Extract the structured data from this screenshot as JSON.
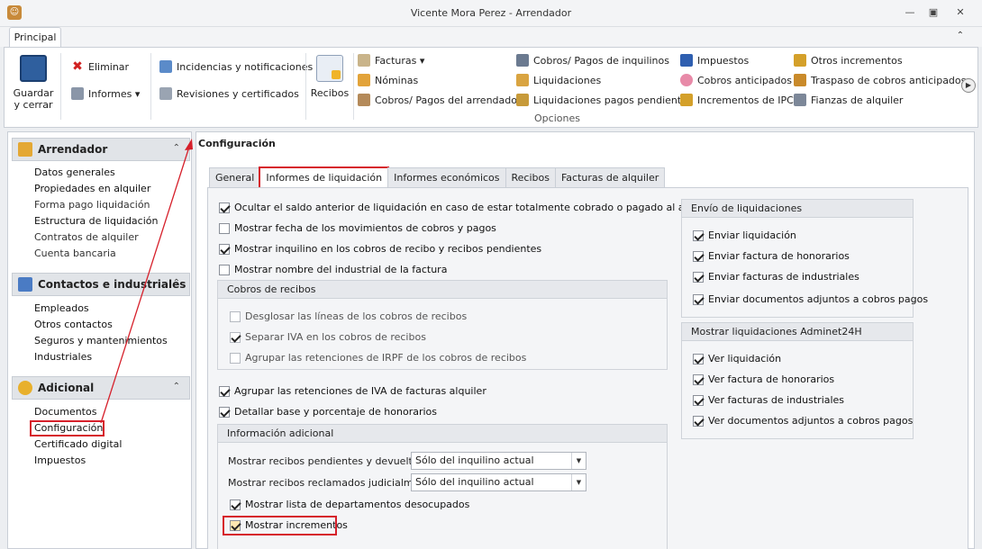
{
  "window": {
    "title": "Vicente Mora Perez - Arrendador",
    "minimize": "—",
    "restore": "▣",
    "close": "✕"
  },
  "ribbon": {
    "tab": "Principal",
    "collapse": "⌃",
    "save": "Guardar y cerrar",
    "delete": "Eliminar",
    "reports": "Informes ▾",
    "incidents": "Incidencias y notificaciones",
    "reviews": "Revisiones y certificados",
    "receipts": "Recibos",
    "invoices": "Facturas ▾",
    "payrolls": "Nóminas",
    "owner_payments": "Cobros/ Pagos del arrendador",
    "tenant_payments": "Cobros/ Pagos de inquilinos",
    "settlements": "Liquidaciones",
    "pending_settlements": "Liquidaciones pagos pendientes",
    "taxes": "Impuestos",
    "advance_payments": "Cobros anticipados",
    "cpi_increments": "Incrementos de IPC",
    "other_increments": "Otros incrementos",
    "advance_transfer": "Traspaso de cobros anticipados",
    "rental_deposits": "Fianzas de alquiler",
    "group_label": "Opciones",
    "more": "▶"
  },
  "sidebar": {
    "sections": [
      {
        "title": "Arrendador",
        "items": [
          "Datos generales",
          "Propiedades en alquiler",
          "Forma pago liquidación",
          "Estructura de liquidación",
          "Contratos de alquiler",
          "Cuenta bancaria"
        ]
      },
      {
        "title": "Contactos e industriales",
        "items": [
          "Empleados",
          "Otros contactos",
          "Seguros y mantenimientos",
          "Industriales"
        ]
      },
      {
        "title": "Adicional",
        "items": [
          "Documentos",
          "Configuración",
          "Certificado digital",
          "Impuestos"
        ]
      }
    ],
    "chevron": "⌃"
  },
  "main": {
    "title": "Configuración",
    "tabs": [
      "General",
      "Informes de liquidación",
      "Informes económicos",
      "Recibos",
      "Facturas de alquiler"
    ],
    "options": {
      "hide_prev_balance": "Ocultar el saldo anterior de liquidación en caso de estar totalmente cobrado o pagado al arrendador",
      "show_move_dates": "Mostrar fecha de los movimientos de cobros y pagos",
      "show_tenant": "Mostrar inquilino en los cobros de recibo y recibos pendientes",
      "show_industrial": "Mostrar nombre del industrial de la factura",
      "group_vat": "Agrupar las retenciones de IVA de facturas alquiler",
      "detail_fees": "Detallar base y porcentaje de honorarios"
    },
    "receipts_group": {
      "title": "Cobros de recibos",
      "split_lines": "Desglosar las líneas de los cobros de recibos",
      "separate_vat": "Separar IVA en los cobros de recibos",
      "group_irpf": "Agrupar las retenciones de IRPF de los cobros de recibos"
    },
    "additional": {
      "title": "Información adicional",
      "pending_label": "Mostrar recibos pendientes y devueltos:",
      "pending_value": "Sólo del inquilino actual",
      "claimed_label": "Mostrar recibos reclamados judicialmente:",
      "claimed_value": "Sólo del inquilino actual",
      "vacant_list": "Mostrar lista de departamentos desocupados",
      "show_increments": "Mostrar incrementos",
      "dropdown_arrow": "▼"
    },
    "sending": {
      "title": "Envío de liquidaciones",
      "send_settlement": "Enviar liquidación",
      "send_fees_invoice": "Enviar factura de honorarios",
      "send_industrial_invoices": "Enviar facturas de industriales",
      "send_attachments": "Enviar documentos adjuntos a cobros pagos"
    },
    "adminet": {
      "title": "Mostrar liquidaciones Adminet24H",
      "view_settlement": "Ver liquidación",
      "view_fees_invoice": "Ver factura de honorarios",
      "view_industrial_invoices": "Ver facturas de industriales",
      "view_attachments": "Ver documentos adjuntos a cobros pagos"
    }
  },
  "colors": {
    "highlight": "#d6202b"
  }
}
